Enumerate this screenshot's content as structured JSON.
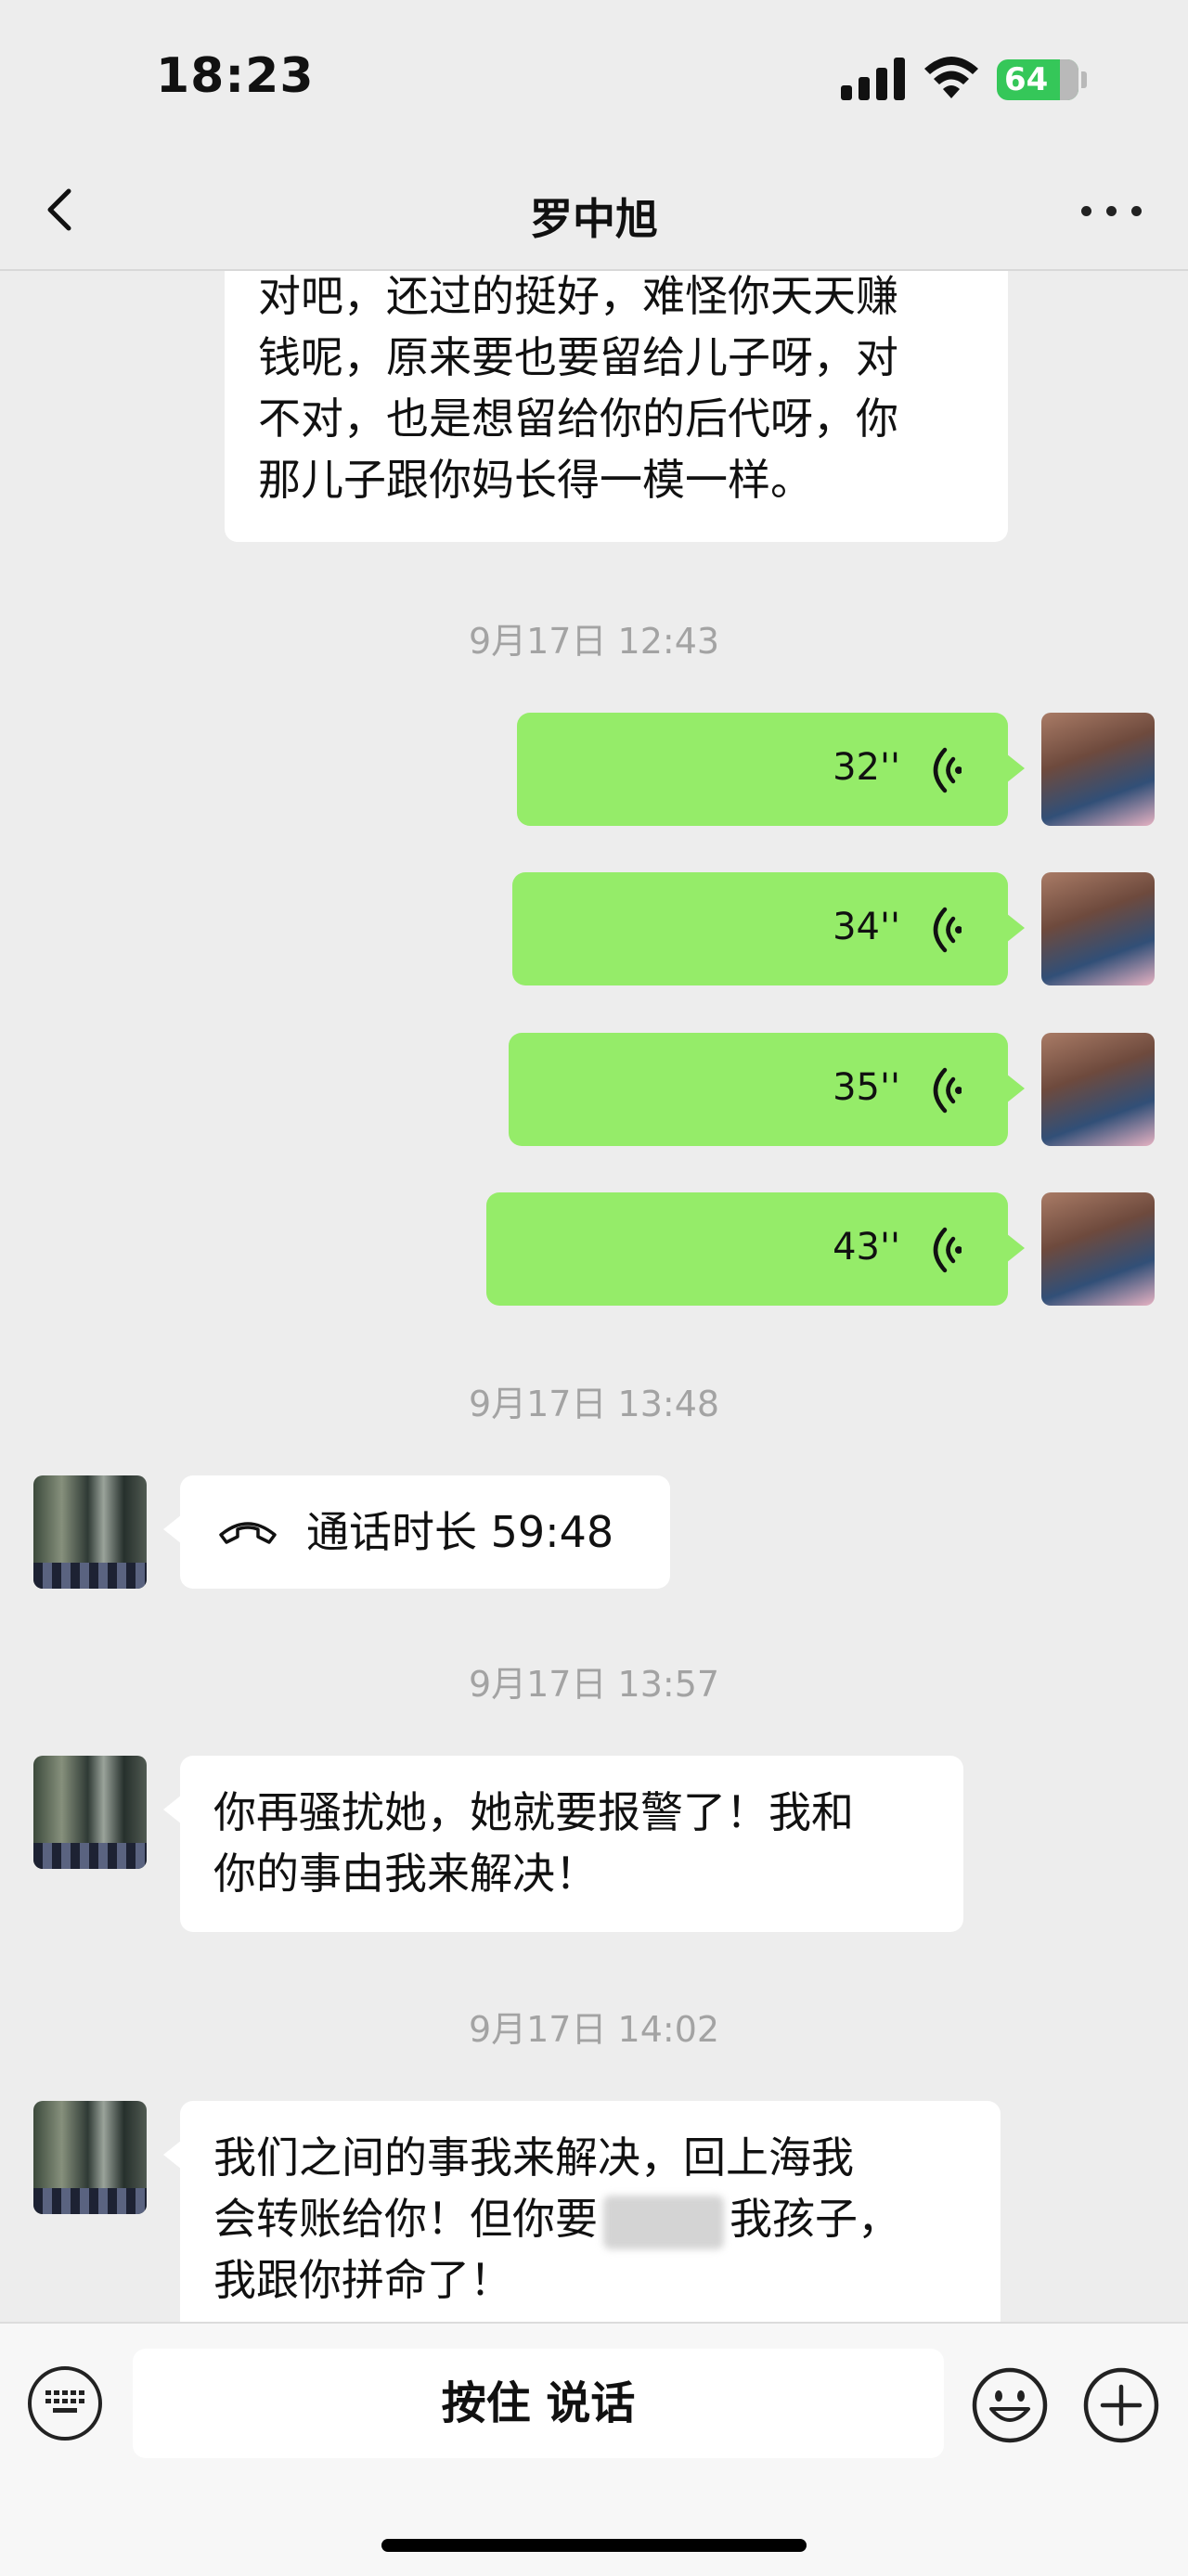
{
  "status_bar": {
    "time": "18:23",
    "battery": "64"
  },
  "nav": {
    "title": "罗中旭",
    "back_icon": "chevron-left-icon",
    "more_icon": "more-dots-icon"
  },
  "messages": {
    "m0_lines": [
      "对吧，还过的挺好，难怪你天天赚",
      "钱呢，原来要也要留给儿子呀，对",
      "不对，也是想留给你的后代呀，你",
      "那儿子跟你妈长得一模一样。"
    ],
    "ts1": "9月17日 12:43",
    "voice": [
      "32''",
      "34''",
      "35''",
      "43''"
    ],
    "ts2": "9月17日 13:48",
    "call_text": "通话时长 59:48",
    "ts3": "9月17日 13:57",
    "m6_lines": [
      "你再骚扰她，她就要报警了！我和",
      "你的事由我来解决！"
    ],
    "ts4": "9月17日 14:02",
    "m8_line1": "我们之间的事我来解决，回上海我",
    "m8_line2a": "会转账给你！但你要",
    "m8_line2b": "我孩子，",
    "m8_line3": "我跟你拼命了！"
  },
  "input_bar": {
    "hold_label": "按住 说话"
  },
  "colors": {
    "self_bubble": "#95ec69",
    "other_bubble": "#ffffff",
    "background": "#ededed",
    "battery": "#35c759"
  }
}
